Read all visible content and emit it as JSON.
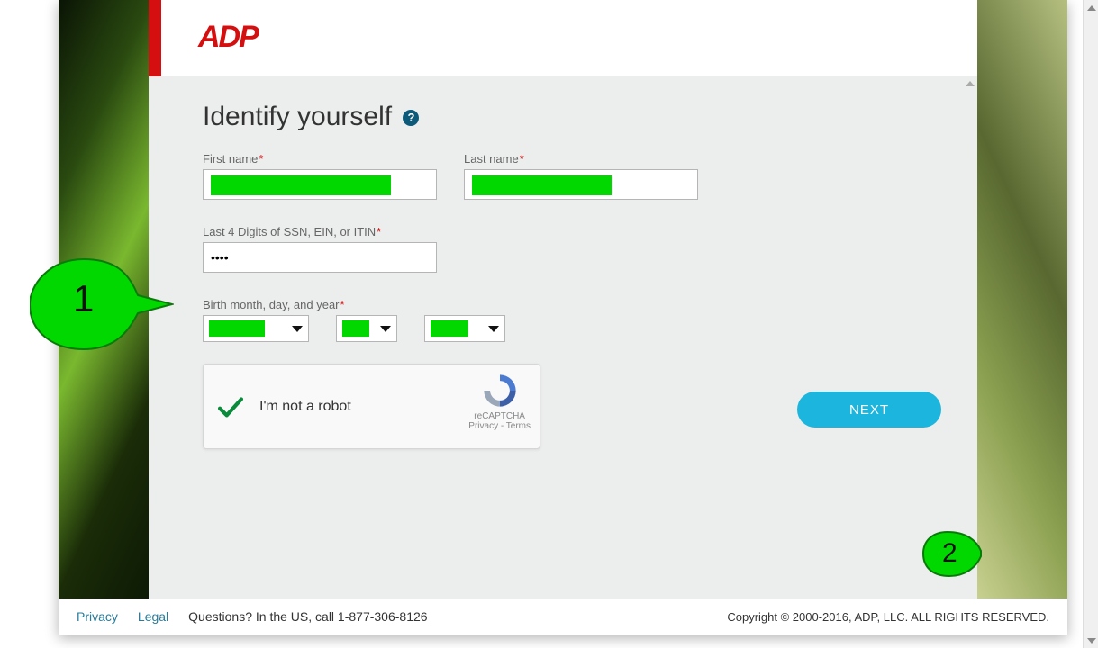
{
  "logo_text": "ADP",
  "page_title": "Identify yourself",
  "help_glyph": "?",
  "form": {
    "first_name": {
      "label": "First name",
      "value": ""
    },
    "last_name": {
      "label": "Last name",
      "value": ""
    },
    "ssn": {
      "label": "Last 4 Digits of SSN, EIN, or ITIN",
      "value": "••••"
    },
    "birth": {
      "label": "Birth month, day, and year"
    }
  },
  "recaptcha": {
    "label": "I'm not a robot",
    "brand": "reCAPTCHA",
    "links": "Privacy - Terms"
  },
  "buttons": {
    "next": "NEXT"
  },
  "footer": {
    "privacy": "Privacy",
    "legal": "Legal",
    "questions": "Questions? In the US, call 1-877-306-8126",
    "copyright": "Copyright © 2000-2016, ADP, LLC. ALL RIGHTS RESERVED."
  },
  "annotations": {
    "one": "1",
    "two": "2"
  }
}
